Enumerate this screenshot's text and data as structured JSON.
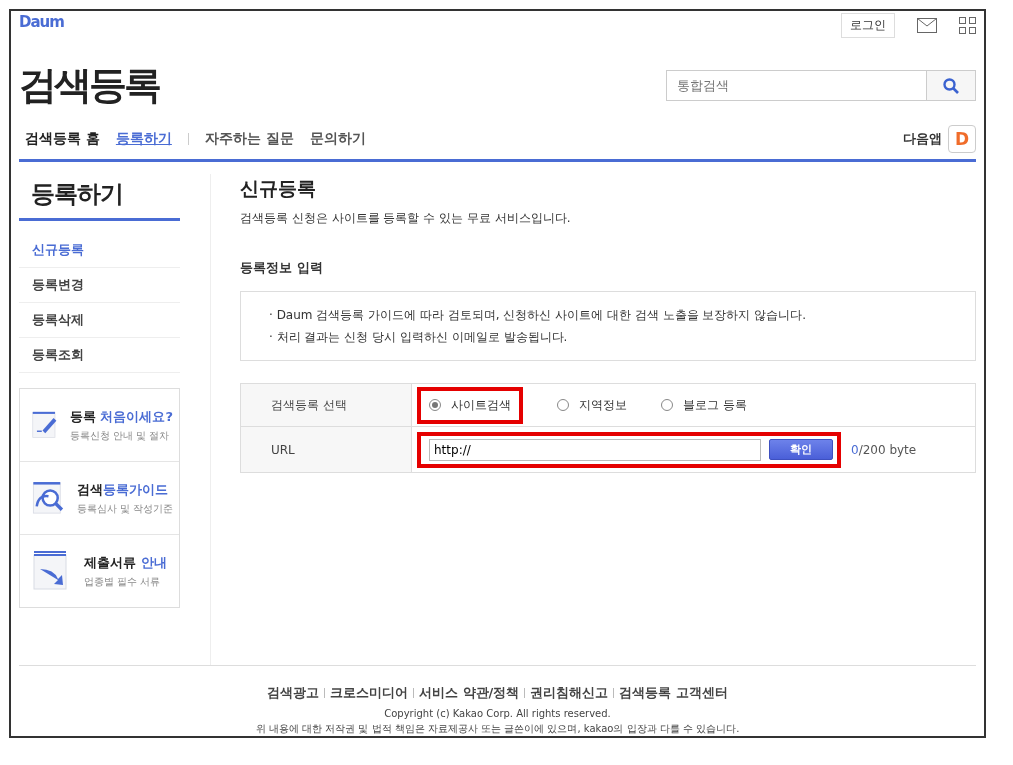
{
  "header": {
    "logo": "Daum",
    "login": "로그인",
    "title": "검색등록",
    "search": {
      "placeholder": "통합검색"
    },
    "nav": [
      {
        "label": "검색등록 홈",
        "selected": false
      },
      {
        "label": "등록하기",
        "selected": true
      },
      {
        "label": "자주하는 질문",
        "selected": false
      },
      {
        "label": "문의하기",
        "selected": false
      }
    ],
    "app_label": "다음앱",
    "app_badge": "D"
  },
  "sidebar": {
    "title": "등록하기",
    "items": [
      {
        "label": "신규등록",
        "selected": true
      },
      {
        "label": "등록변경",
        "selected": false
      },
      {
        "label": "등록삭제",
        "selected": false
      },
      {
        "label": "등록조회",
        "selected": false
      }
    ],
    "cards": [
      {
        "kind": "pencil",
        "title": "등록 **처음이세요?**",
        "sub": "등록신청 안내 및 절차"
      },
      {
        "kind": "magnifier",
        "title": "검색**등록가이드**",
        "sub": "등록심사 및 작성기준"
      },
      {
        "kind": "document",
        "title": "제출서류 **안내**",
        "sub": "업종별 필수 서류"
      }
    ]
  },
  "main": {
    "title": "신규등록",
    "description": "검색등록 신청은 사이트를 등록할 수 있는 무료 서비스입니다.",
    "section": "등록정보 입력",
    "notices": [
      "· Daum 검색등록 가이드에 따라 검토되며, 신청하신 사이트에 대한 검색 노출을 보장하지 않습니다.",
      "· 처리 결과는 신청 당시 입력하신 이메일로 발송됩니다."
    ],
    "form": {
      "type_label": "검색등록 선택",
      "types": [
        {
          "label": "사이트검색",
          "selected": true
        },
        {
          "label": "지역정보",
          "selected": false
        },
        {
          "label": "블로그 등록",
          "selected": false
        }
      ],
      "url_label": "URL",
      "url_value": "http://",
      "confirm": "확인",
      "count": "0",
      "count_rest": "/200 byte"
    }
  },
  "footer": {
    "links": [
      "검색광고",
      "크로스미디어",
      "서비스 약관/정책",
      "권리침해신고",
      "검색등록 고객센터"
    ],
    "copyright": "Copyright (c) Kakao Corp. All rights reserved.",
    "disclaimer": "위 내용에 대한 저작권 및 법적 책임은 자료제공사 또는 글쓴이에 있으며, kakao의 입장과 다를 수 있습니다."
  }
}
